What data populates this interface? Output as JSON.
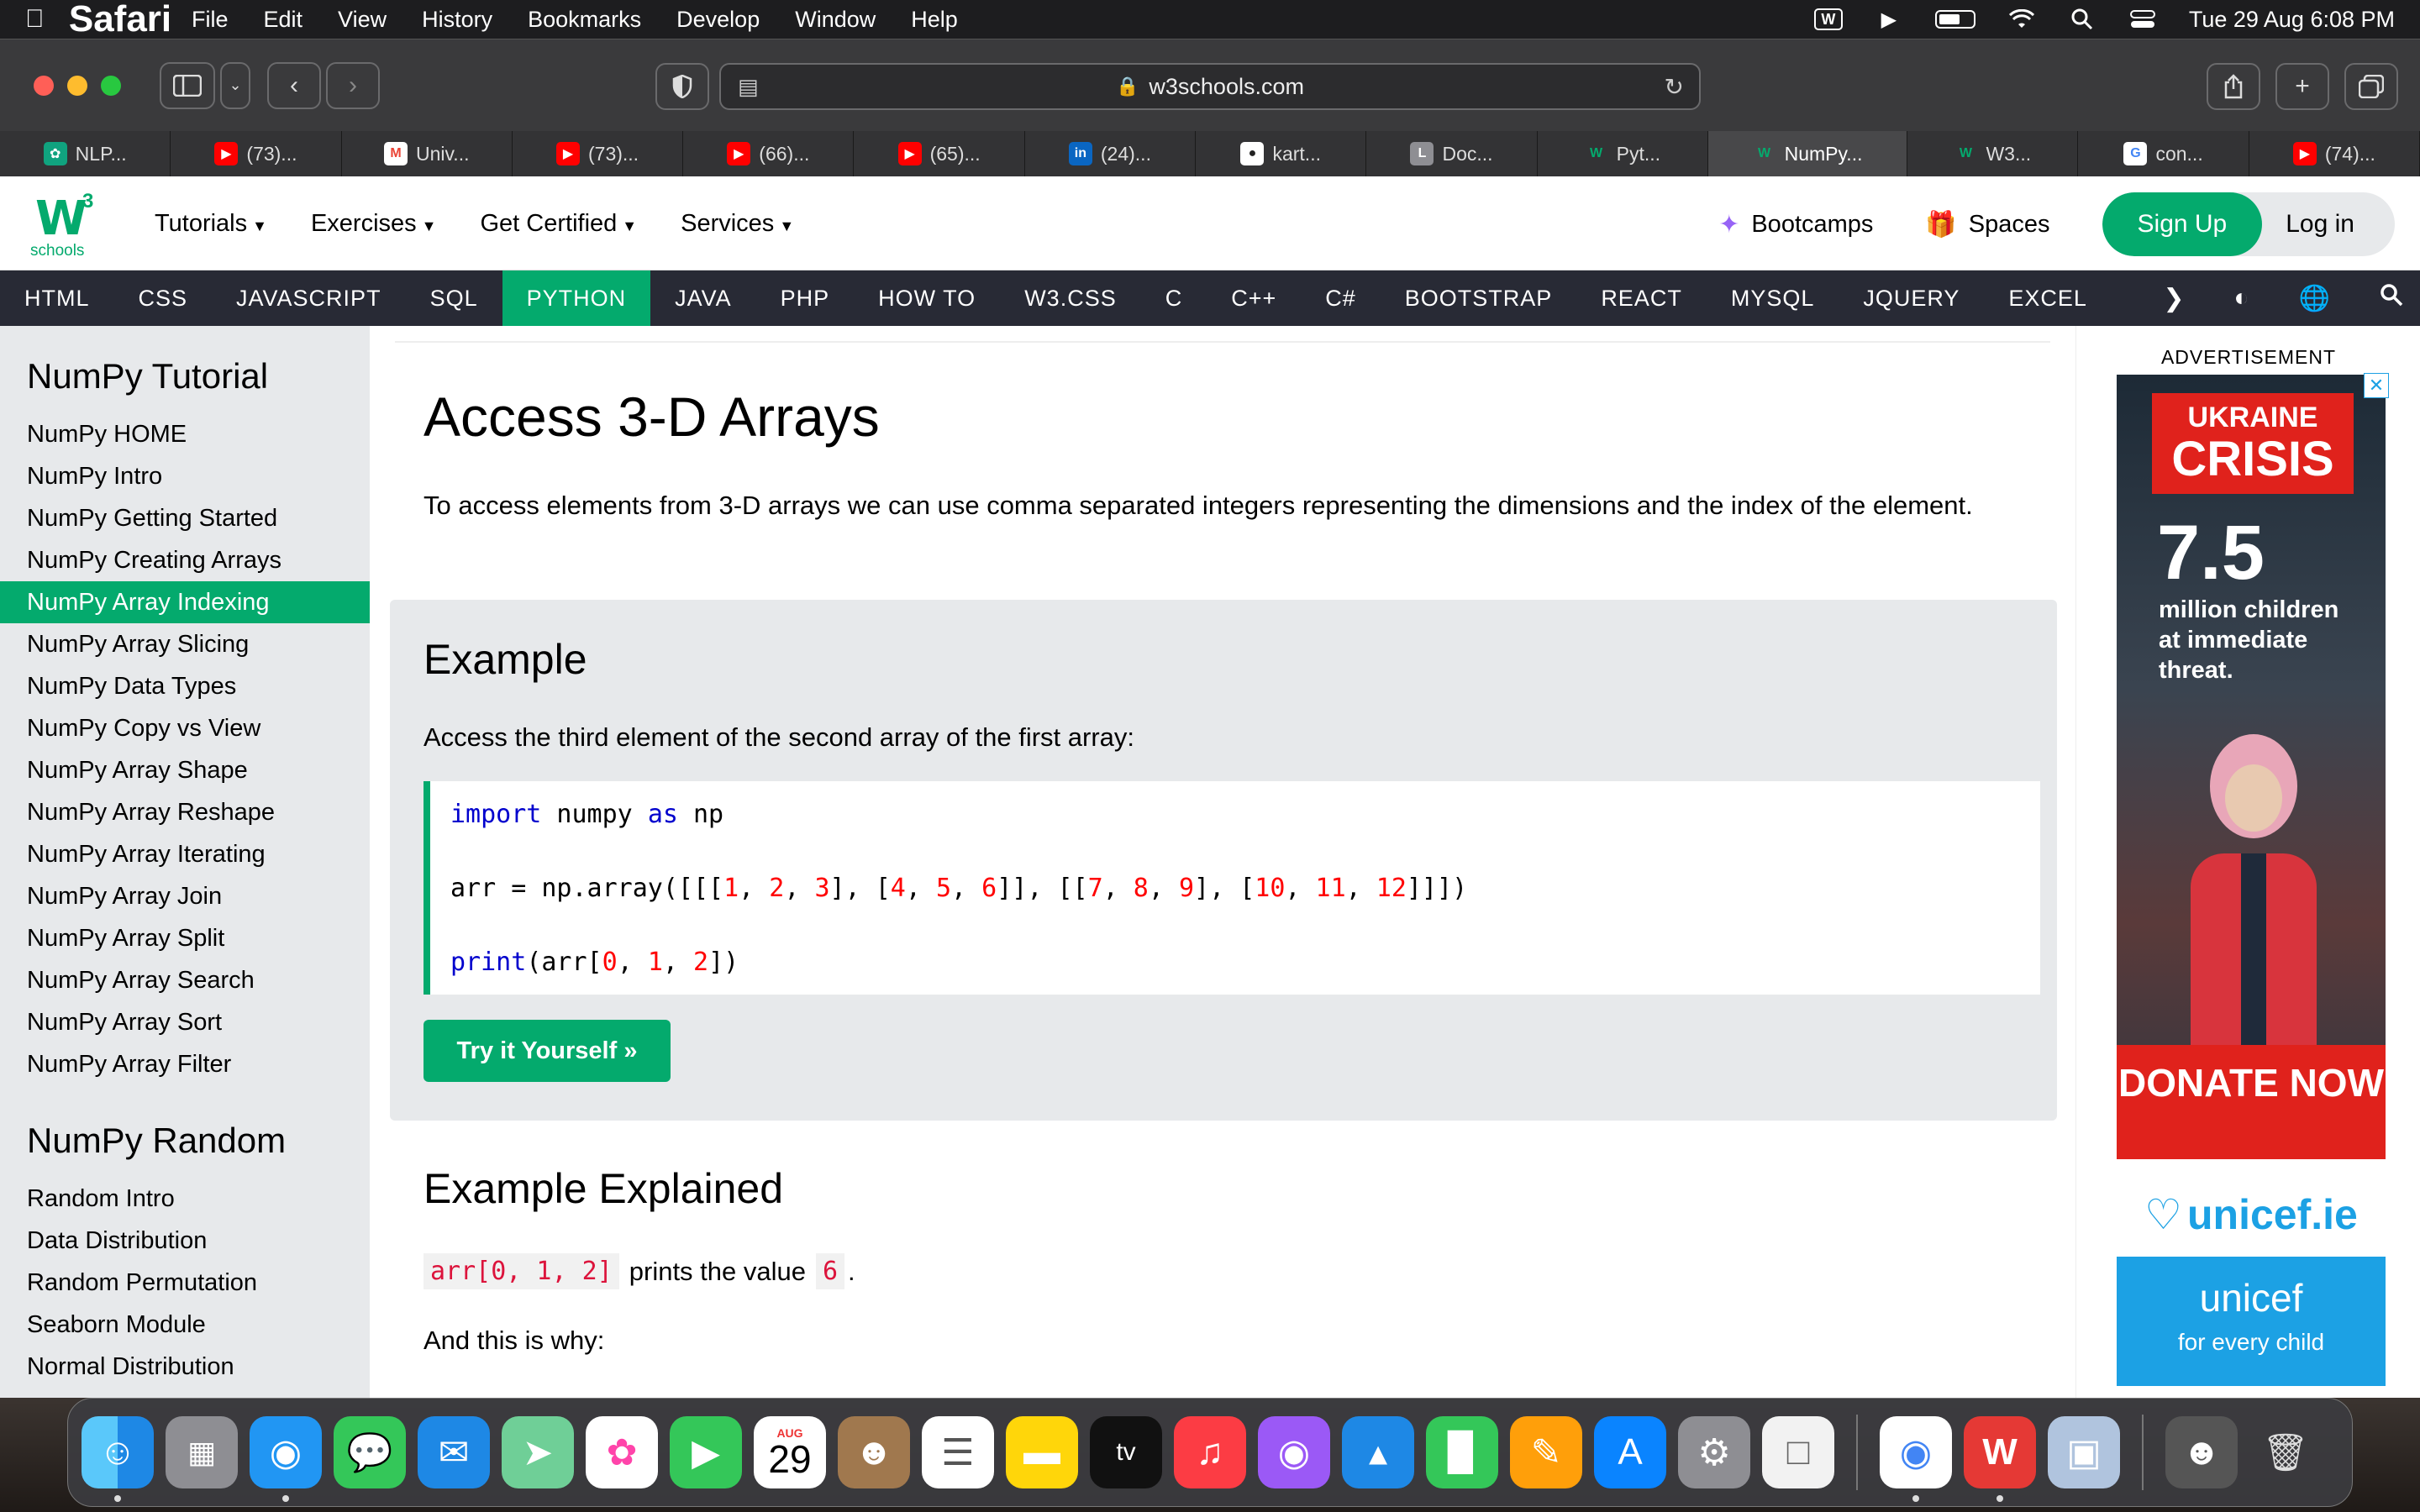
{
  "menubar": {
    "app_name": "Safari",
    "menus": [
      "File",
      "Edit",
      "View",
      "History",
      "Bookmarks",
      "Develop",
      "Window",
      "Help"
    ],
    "datetime": "Tue 29 Aug  6:08 PM"
  },
  "browser": {
    "url": "w3schools.com",
    "tabs": [
      {
        "label": "NLP...",
        "icon": "openai-icon",
        "color": "#10a37f"
      },
      {
        "label": "(73)...",
        "icon": "youtube-icon",
        "color": "#ff0000"
      },
      {
        "label": "Univ...",
        "icon": "gmail-icon",
        "color": "#ea4335"
      },
      {
        "label": "(73)...",
        "icon": "youtube-icon",
        "color": "#ff0000"
      },
      {
        "label": "(66)...",
        "icon": "youtube-icon",
        "color": "#ff0000"
      },
      {
        "label": "(65)...",
        "icon": "youtube-icon",
        "color": "#ff0000"
      },
      {
        "label": "(24)...",
        "icon": "linkedin-icon",
        "color": "#0a66c2"
      },
      {
        "label": "kart...",
        "icon": "github-icon",
        "color": "#444444"
      },
      {
        "label": "Doc...",
        "icon": "doc-icon",
        "color": "#8e8e93"
      },
      {
        "label": "Pyt...",
        "icon": "w3schools-icon",
        "color": "#04aa6d"
      },
      {
        "label": "NumPy...",
        "icon": "w3schools-icon",
        "color": "#04aa6d",
        "active": true
      },
      {
        "label": "W3...",
        "icon": "w3schools-icon",
        "color": "#04aa6d"
      },
      {
        "label": "con...",
        "icon": "google-icon",
        "color": "#4285f4"
      },
      {
        "label": "(74)...",
        "icon": "youtube-icon",
        "color": "#ff0000"
      }
    ]
  },
  "w3": {
    "logo_sup": "3",
    "logo_text": "schools",
    "menu": [
      "Tutorials",
      "Exercises",
      "Get Certified",
      "Services"
    ],
    "bootcamps": "Bootcamps",
    "spaces": "Spaces",
    "signup": "Sign Up",
    "login": "Log in",
    "subjects": [
      "HTML",
      "CSS",
      "JAVASCRIPT",
      "SQL",
      "PYTHON",
      "JAVA",
      "PHP",
      "HOW TO",
      "W3.CSS",
      "C",
      "C++",
      "C#",
      "BOOTSTRAP",
      "REACT",
      "MYSQL",
      "JQUERY",
      "EXCEL"
    ],
    "active_subject": "PYTHON"
  },
  "sidebar": {
    "title1": "NumPy Tutorial",
    "items1": [
      "NumPy HOME",
      "NumPy Intro",
      "NumPy Getting Started",
      "NumPy Creating Arrays",
      "NumPy Array Indexing",
      "NumPy Array Slicing",
      "NumPy Data Types",
      "NumPy Copy vs View",
      "NumPy Array Shape",
      "NumPy Array Reshape",
      "NumPy Array Iterating",
      "NumPy Array Join",
      "NumPy Array Split",
      "NumPy Array Search",
      "NumPy Array Sort",
      "NumPy Array Filter"
    ],
    "active_item": "NumPy Array Indexing",
    "title2": "NumPy Random",
    "items2": [
      "Random Intro",
      "Data Distribution",
      "Random Permutation",
      "Seaborn Module",
      "Normal Distribution"
    ]
  },
  "content": {
    "heading": "Access 3-D Arrays",
    "intro": "To access elements from 3-D arrays we can use comma separated integers representing the dimensions and the index of the element.",
    "example_title": "Example",
    "example_desc": "Access the third element of the second array of the first array:",
    "code": {
      "line1_kw1": "import",
      "line1_mid": " numpy ",
      "line1_kw2": "as",
      "line1_end": " np",
      "line2": "arr = np.array([[[1, 2, 3], [4, 5, 6]], [[7, 8, 9], [10, 11, 12]]])",
      "line3_kw": "print",
      "line3_rest": "(arr[0, 1, 2])"
    },
    "try_button": "Try it Yourself »",
    "explained_title": "Example Explained",
    "explain_code": "arr[0, 1, 2]",
    "explain_text": "prints the value",
    "explain_value": "6",
    "explain_period": ".",
    "why": "And this is why:"
  },
  "ad": {
    "label": "ADVERTISEMENT",
    "headline1": "UKRAINE",
    "headline2": "CRISIS",
    "stat": "7.5",
    "stat_text": "million children at immediate threat.",
    "donate": "DONATE NOW",
    "brand": "unicef.ie",
    "brand2": "unicef",
    "tagline": "for every child"
  },
  "dock": {
    "calendar_month": "AUG",
    "calendar_day": "29",
    "apps": [
      "finder",
      "launchpad",
      "safari",
      "messages",
      "mail",
      "maps",
      "photos",
      "facetime",
      "calendar",
      "contacts",
      "reminders",
      "notes",
      "tv",
      "music",
      "podcasts",
      "keynote",
      "numbers",
      "pages",
      "app-store",
      "system-settings",
      "preview",
      "chrome",
      "wps",
      "preview-photo",
      "user-photo",
      "trash"
    ]
  }
}
